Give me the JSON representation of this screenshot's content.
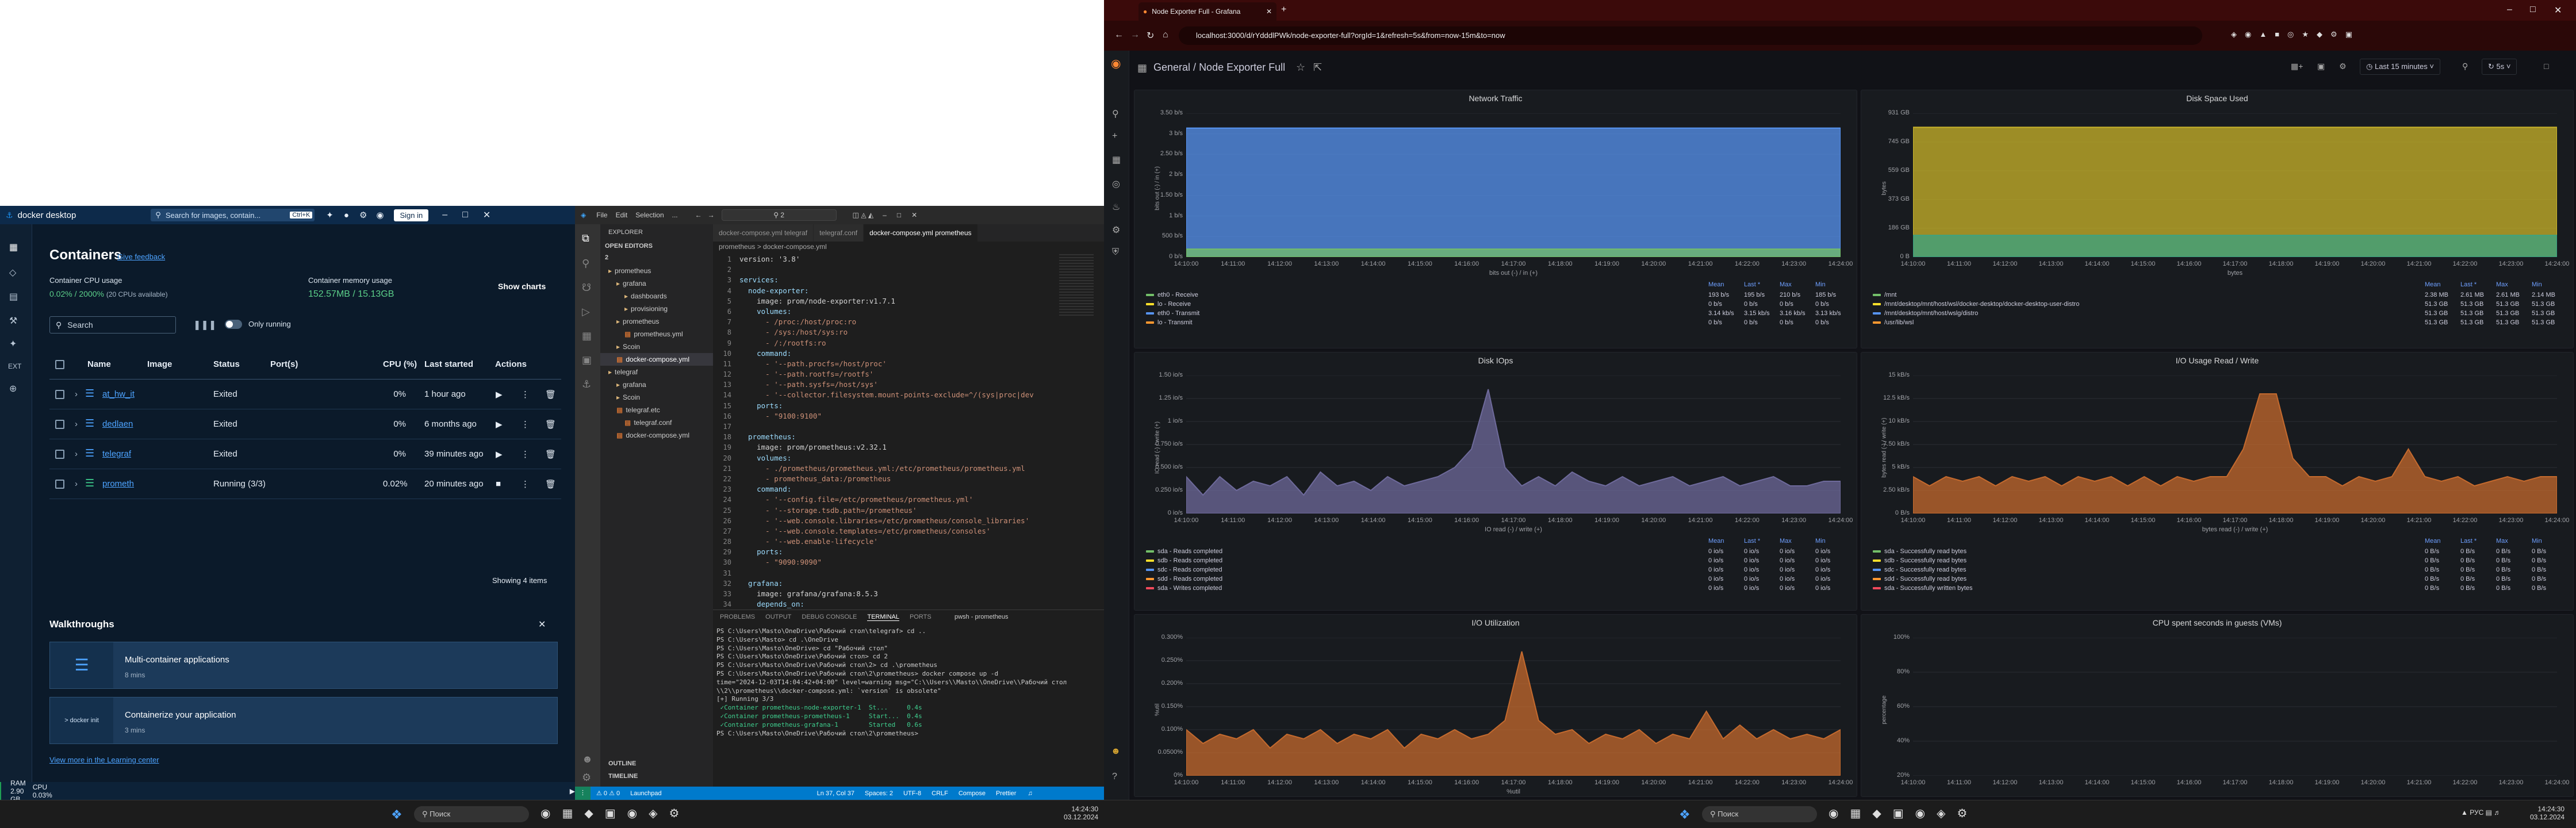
{
  "docker": {
    "app_title": "docker desktop",
    "search_placeholder": "Search for images, contain...",
    "search_shortcut": "Ctrl+K",
    "sign_in": "Sign in",
    "page_title": "Containers",
    "feedback": "Give feedback",
    "cpu_label": "Container CPU usage",
    "cpu_value": "0.02% / 2000%",
    "cpu_sub": "(20 CPUs available)",
    "mem_label": "Container memory usage",
    "mem_value": "152.57MB / 15.13GB",
    "show_charts": "Show charts",
    "search_box": "Search",
    "only_running": "Only running",
    "columns": [
      "Name",
      "Image",
      "Status",
      "Port(s)",
      "CPU (%)",
      "Last started",
      "Actions"
    ],
    "rows": [
      {
        "name": "at_hw_it",
        "status": "Exited",
        "cpu": "0%",
        "last": "1 hour ago"
      },
      {
        "name": "dedlaen",
        "status": "Exited",
        "cpu": "0%",
        "last": "6 months ago"
      },
      {
        "name": "telegraf",
        "status": "Exited",
        "cpu": "0%",
        "last": "39 minutes ago"
      },
      {
        "name": "prometh",
        "status": "Running (3/3)",
        "cpu": "0.02%",
        "last": "20 minutes ago"
      }
    ],
    "showing": "Showing 4 items",
    "walkthroughs": "Walkthroughs",
    "walk": [
      {
        "title": "Multi-container applications",
        "time": "8 mins"
      },
      {
        "title": "Containerize your application",
        "time": "3 mins"
      }
    ],
    "learning": "View more in the Learning center",
    "status_ram": "RAM 2.90 GB",
    "status_cpu": "CPU 0.03%",
    "side_ext": "EXT"
  },
  "vscode": {
    "menu": [
      "File",
      "Edit",
      "Selection",
      "..."
    ],
    "search": "2",
    "explorer": "EXPLORER",
    "open_editors": "OPEN EDITORS",
    "root": "2",
    "tree": [
      {
        "d": 1,
        "t": "prometheus"
      },
      {
        "d": 2,
        "t": "grafana"
      },
      {
        "d": 3,
        "t": "dashboards"
      },
      {
        "d": 3,
        "t": "provisioning"
      },
      {
        "d": 2,
        "t": "prometheus"
      },
      {
        "d": 3,
        "t": "prometheus.yml"
      },
      {
        "d": 2,
        "t": "Scoin"
      },
      {
        "d": 2,
        "t": "docker-compose.yml"
      },
      {
        "d": 1,
        "t": "telegraf"
      },
      {
        "d": 2,
        "t": "grafana"
      },
      {
        "d": 2,
        "t": "Scoin"
      },
      {
        "d": 2,
        "t": "telegraf.etc"
      },
      {
        "d": 3,
        "t": "telegraf.conf"
      },
      {
        "d": 2,
        "t": "docker-compose.yml"
      }
    ],
    "outline": "OUTLINE",
    "timeline": "TIMELINE",
    "tabs": [
      "docker-compose.yml telegraf",
      "telegraf.conf",
      "docker-compose.yml prometheus"
    ],
    "breadcrumb": "prometheus > docker-compose.yml",
    "code": [
      "version: '3.8'",
      "",
      "services:",
      "  node-exporter:",
      "    image: prom/node-exporter:v1.7.1",
      "    volumes:",
      "      - /proc:/host/proc:ro",
      "      - /sys:/host/sys:ro",
      "      - /:/rootfs:ro",
      "    command:",
      "      - '--path.procfs=/host/proc'",
      "      - '--path.rootfs=/rootfs'",
      "      - '--path.sysfs=/host/sys'",
      "      - '--collector.filesystem.mount-points-exclude=^/(sys|proc|dev",
      "    ports:",
      "      - \"9100:9100\"",
      "",
      "  prometheus:",
      "    image: prom/prometheus:v2.32.1",
      "    volumes:",
      "      - ./prometheus/prometheus.yml:/etc/prometheus/prometheus.yml",
      "      - prometheus_data:/prometheus",
      "    command:",
      "      - '--config.file=/etc/prometheus/prometheus.yml'",
      "      - '--storage.tsdb.path=/prometheus'",
      "      - '--web.console.libraries=/etc/prometheus/console_libraries'",
      "      - '--web.console.templates=/etc/prometheus/consoles'",
      "      - '--web.enable-lifecycle'",
      "    ports:",
      "      - \"9090:9090\"",
      "",
      "  grafana:",
      "    image: grafana/grafana:8.5.3",
      "    depends_on:"
    ],
    "panel_tabs": [
      "PROBLEMS",
      "OUTPUT",
      "DEBUG CONSOLE",
      "TERMINAL",
      "PORTS"
    ],
    "shell": "pwsh - prometheus",
    "terminal": [
      "PS C:\\Users\\Masto\\OneDrive\\Рабочий стол\\telegraf> cd ..",
      "PS C:\\Users\\Masto> cd .\\OneDrive",
      "PS C:\\Users\\Masto\\OneDrive> cd \"Рабочий стол\"",
      "PS C:\\Users\\Masto\\OneDrive\\Рабочий стол> cd 2",
      "PS C:\\Users\\Masto\\OneDrive\\Рабочий стол\\2> cd .\\prometheus",
      "PS C:\\Users\\Masto\\OneDrive\\Рабочий стол\\2\\prometheus> docker compose up -d",
      "time=\"2024-12-03T14:04:42+04:00\" level=warning msg=\"C:\\\\Users\\\\Masto\\\\OneDrive\\\\Рабочий стол",
      "\\\\2\\\\prometheus\\\\docker-compose.yml: `version` is obsolete\"",
      "[+] Running 3/3",
      " ✓Container prometheus-node-exporter-1  St...     0.4s",
      " ✓Container prometheus-prometheus-1     Start...  0.4s",
      " ✓Container prometheus-grafana-1        Started   0.6s",
      "PS C:\\Users\\Masto\\OneDrive\\Рабочий стол\\2\\prometheus> "
    ],
    "status": [
      "Launchpad",
      "Ln 37, Col 37",
      "Spaces: 2",
      "UTF-8",
      "CRLF",
      "Compose",
      "Prettier"
    ]
  },
  "grafana": {
    "tab_title": "Node Exporter Full - Grafana",
    "url": "localhost:3000/d/rYdddlPWk/node-exporter-full?orgId=1&refresh=5s&from=now-15m&to=now",
    "breadcrumb_root": "General",
    "breadcrumb_page": "Node Exporter Full",
    "time_range": "Last 15 minutes",
    "refresh": "5s",
    "legend_header": [
      "Mean",
      "Last *",
      "Max",
      "Min"
    ],
    "panels": {
      "net": {
        "title": "Network Traffic",
        "ylabel": "bits out (-) / in (+)",
        "xlabel": "bits out (-) / in (+)",
        "yticks": [
          "3.50 b/s",
          "3 b/s",
          "2.50 b/s",
          "2 b/s",
          "1.50 b/s",
          "1 b/s",
          "500 b/s",
          "0 b/s"
        ],
        "legend": [
          {
            "name": "eth0 - Receive",
            "color": "#73bf69",
            "v": [
              "193 b/s",
              "195 b/s",
              "210 b/s",
              "185 b/s"
            ]
          },
          {
            "name": "lo - Receive",
            "color": "#fade2a",
            "v": [
              "0 b/s",
              "0 b/s",
              "0 b/s",
              "0 b/s"
            ]
          },
          {
            "name": "eth0 - Transmit",
            "color": "#5794f2",
            "v": [
              "3.14 kb/s",
              "3.15 kb/s",
              "3.16 kb/s",
              "3.13 kb/s"
            ]
          },
          {
            "name": "lo - Transmit",
            "color": "#ff9830",
            "v": [
              "0 b/s",
              "0 b/s",
              "0 b/s",
              "0 b/s"
            ]
          }
        ]
      },
      "disk": {
        "title": "Disk Space Used",
        "ylabel": "bytes",
        "xlabel": "bytes",
        "yticks": [
          "931 GB",
          "745 GB",
          "559 GB",
          "373 GB",
          "186 GB",
          "0 B"
        ],
        "legend": [
          {
            "name": "/mnt",
            "color": "#73bf69",
            "v": [
              "2.38 MB",
              "2.61 MB",
              "2.61 MB",
              "2.14 MB"
            ]
          },
          {
            "name": "/mnt/desktop/mnt/host/wsl/docker-desktop/docker-desktop-user-distro",
            "color": "#fade2a",
            "v": [
              "51.3 GB",
              "51.3 GB",
              "51.3 GB",
              "51.3 GB"
            ]
          },
          {
            "name": "/mnt/desktop/mnt/host/wslg/distro",
            "color": "#5794f2",
            "v": [
              "51.3 GB",
              "51.3 GB",
              "51.3 GB",
              "51.3 GB"
            ]
          },
          {
            "name": "/usr/lib/wsl",
            "color": "#ff9830",
            "v": [
              "51.3 GB",
              "51.3 GB",
              "51.3 GB",
              "51.3 GB"
            ]
          }
        ]
      },
      "iops": {
        "title": "Disk IOps",
        "ylabel": "IO read (-) / write (+)",
        "xlabel": "IO read (-) / write (+)",
        "yticks": [
          "1.50 io/s",
          "1.25 io/s",
          "1 io/s",
          "0.750 io/s",
          "0.500 io/s",
          "0.250 io/s",
          "0 io/s"
        ],
        "legend": [
          {
            "name": "sda - Reads completed",
            "color": "#73bf69",
            "v": [
              "0 io/s",
              "0 io/s",
              "0 io/s",
              "0 io/s"
            ]
          },
          {
            "name": "sdb - Reads completed",
            "color": "#fade2a",
            "v": [
              "0 io/s",
              "0 io/s",
              "0 io/s",
              "0 io/s"
            ]
          },
          {
            "name": "sdc - Reads completed",
            "color": "#5794f2",
            "v": [
              "0 io/s",
              "0 io/s",
              "0 io/s",
              "0 io/s"
            ]
          },
          {
            "name": "sdd - Reads completed",
            "color": "#ff9830",
            "v": [
              "0 io/s",
              "0 io/s",
              "0 io/s",
              "0 io/s"
            ]
          },
          {
            "name": "sda - Writes completed",
            "color": "#f2495c",
            "v": [
              "0 io/s",
              "0 io/s",
              "0 io/s",
              "0 io/s"
            ]
          }
        ]
      },
      "iorw": {
        "title": "I/O Usage Read / Write",
        "ylabel": "bytes read (-) / write (+)",
        "xlabel": "bytes read (-) / write (+)",
        "yticks": [
          "15 kB/s",
          "12.5 kB/s",
          "10 kB/s",
          "7.50 kB/s",
          "5 kB/s",
          "2.50 kB/s",
          "0 B/s"
        ],
        "legend": [
          {
            "name": "sda - Successfully read bytes",
            "color": "#73bf69",
            "v": [
              "0 B/s",
              "0 B/s",
              "0 B/s",
              "0 B/s"
            ]
          },
          {
            "name": "sdb - Successfully read bytes",
            "color": "#fade2a",
            "v": [
              "0 B/s",
              "0 B/s",
              "0 B/s",
              "0 B/s"
            ]
          },
          {
            "name": "sdc - Successfully read bytes",
            "color": "#5794f2",
            "v": [
              "0 B/s",
              "0 B/s",
              "0 B/s",
              "0 B/s"
            ]
          },
          {
            "name": "sdd - Successfully read bytes",
            "color": "#ff9830",
            "v": [
              "0 B/s",
              "0 B/s",
              "0 B/s",
              "0 B/s"
            ]
          },
          {
            "name": "sda - Successfully written bytes",
            "color": "#f2495c",
            "v": [
              "0 B/s",
              "0 B/s",
              "0 B/s",
              "0 B/s"
            ]
          }
        ]
      },
      "util": {
        "title": "I/O Utilization",
        "ylabel": "%util",
        "xlabel": "%util",
        "yticks": [
          "0.300%",
          "0.250%",
          "0.200%",
          "0.150%",
          "0.100%",
          "0.0500%",
          "0%"
        ]
      },
      "cpuvm": {
        "title": "CPU spent seconds in guests (VMs)",
        "ylabel": "percentage",
        "yticks": [
          "100%",
          "80%",
          "60%",
          "40%",
          "20%"
        ]
      }
    },
    "xticks": [
      "14:10:00",
      "14:11:00",
      "14:12:00",
      "14:13:00",
      "14:14:00",
      "14:15:00",
      "14:16:00",
      "14:17:00",
      "14:18:00",
      "14:19:00",
      "14:20:00",
      "14:21:00",
      "14:22:00",
      "14:23:00",
      "14:24:00"
    ]
  },
  "chart_data": [
    {
      "type": "area",
      "title": "Network Traffic",
      "ylabel": "bits out (-) / in (+)",
      "ylim": [
        0,
        3500
      ],
      "series": [
        {
          "name": "eth0 - Transmit",
          "values": [
            3140,
            3140,
            3140,
            3140,
            3140,
            3140,
            3140,
            3140,
            3140,
            3140,
            3140,
            3140,
            3140,
            3140,
            3140
          ]
        },
        {
          "name": "eth0 - Receive",
          "values": [
            193,
            193,
            193,
            193,
            193,
            193,
            193,
            193,
            193,
            193,
            193,
            193,
            193,
            193,
            193
          ]
        }
      ]
    },
    {
      "type": "area",
      "title": "Disk Space Used",
      "ylabel": "bytes",
      "ylim": [
        0,
        931
      ],
      "series": [
        {
          "name": "/mnt/desktop/mnt/host/wsl/docker-desktop/docker-desktop-user-distro",
          "values": [
            840,
            840,
            840,
            840,
            840,
            840,
            840,
            840,
            840,
            840,
            840,
            840,
            840,
            840,
            840
          ]
        },
        {
          "name": "/mnt/desktop/mnt/host/wslg/distro",
          "values": [
            140,
            140,
            140,
            140,
            140,
            140,
            140,
            140,
            140,
            140,
            140,
            140,
            140,
            140,
            140
          ]
        }
      ]
    },
    {
      "type": "area",
      "title": "Disk IOps",
      "ylabel": "IO read (-) / write (+)",
      "ylim": [
        0,
        1.5
      ],
      "series": [
        {
          "name": "sda - Writes completed",
          "values": [
            0.4,
            0.2,
            0.4,
            0.25,
            0.35,
            0.3,
            0.4,
            0.2,
            0.45,
            0.3,
            0.35,
            0.25,
            0.4,
            0.3,
            0.35,
            0.4,
            0.5,
            0.7,
            1.35,
            0.5,
            0.3,
            0.4,
            0.3,
            0.45,
            0.35,
            0.3,
            0.4,
            0.3,
            0.35,
            0.4,
            0.3,
            0.35,
            0.4,
            0.3,
            0.35,
            0.4,
            0.3,
            0.3,
            0.35,
            0.35
          ]
        }
      ]
    },
    {
      "type": "area",
      "title": "I/O Usage Read / Write",
      "ylabel": "bytes read (-) / write (+)",
      "ylim": [
        0,
        15
      ],
      "series": [
        {
          "name": "sda - Successfully written bytes",
          "values": [
            4,
            3,
            4,
            3.5,
            4,
            3,
            4,
            3.5,
            4,
            3,
            4,
            3.5,
            4,
            3,
            4,
            3,
            4,
            3.5,
            4,
            4,
            7,
            13,
            13,
            6,
            4,
            4,
            3,
            4,
            3.5,
            4,
            7,
            4,
            3.5,
            4,
            3,
            3.5,
            4,
            3.5,
            4,
            4
          ]
        }
      ]
    },
    {
      "type": "area",
      "title": "I/O Utilization",
      "ylabel": "%util",
      "ylim": [
        0,
        0.3
      ],
      "series": [
        {
          "name": "sda",
          "values": [
            0.1,
            0.07,
            0.09,
            0.08,
            0.1,
            0.06,
            0.09,
            0.08,
            0.1,
            0.07,
            0.09,
            0.08,
            0.1,
            0.06,
            0.09,
            0.08,
            0.1,
            0.08,
            0.09,
            0.12,
            0.27,
            0.12,
            0.09,
            0.1,
            0.07,
            0.09,
            0.08,
            0.1,
            0.07,
            0.09,
            0.08,
            0.14,
            0.08,
            0.11,
            0.08,
            0.1,
            0.08,
            0.09,
            0.08,
            0.1
          ]
        }
      ]
    }
  ]
}
